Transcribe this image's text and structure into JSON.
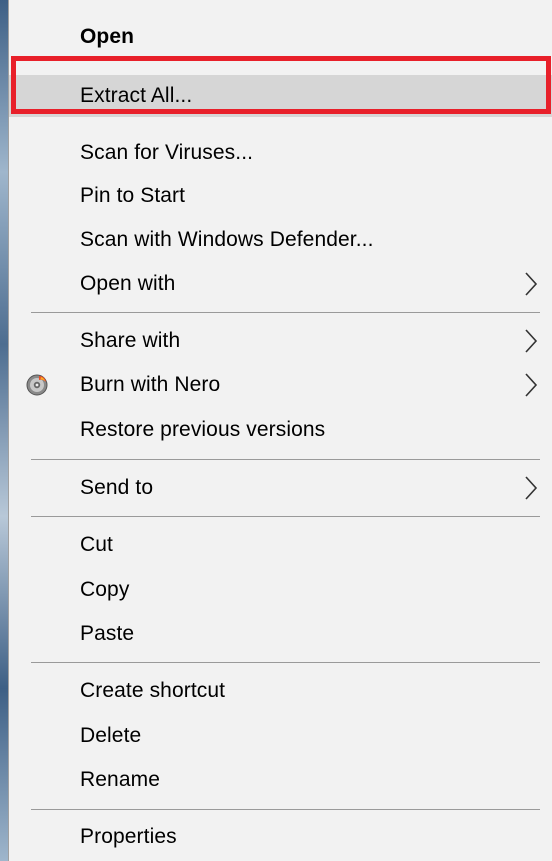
{
  "menu": {
    "items": [
      {
        "label": "Open"
      },
      {
        "label": "Extract All..."
      },
      {
        "label": "Scan for Viruses..."
      },
      {
        "label": "Pin to Start"
      },
      {
        "label": "Scan with Windows Defender..."
      },
      {
        "label": "Open with"
      },
      {
        "label": "Share with"
      },
      {
        "label": "Burn with Nero"
      },
      {
        "label": "Restore previous versions"
      },
      {
        "label": "Send to"
      },
      {
        "label": "Cut"
      },
      {
        "label": "Copy"
      },
      {
        "label": "Paste"
      },
      {
        "label": "Create shortcut"
      },
      {
        "label": "Delete"
      },
      {
        "label": "Rename"
      },
      {
        "label": "Properties"
      }
    ],
    "highlighted_item": "Extract All...",
    "annotation_color": "#e8202a",
    "hover_color": "#d6d6d6",
    "background_color": "#f2f2f2"
  },
  "icons": {
    "submenu": "chevron-right-icon",
    "nero": "nero-disc-icon"
  }
}
